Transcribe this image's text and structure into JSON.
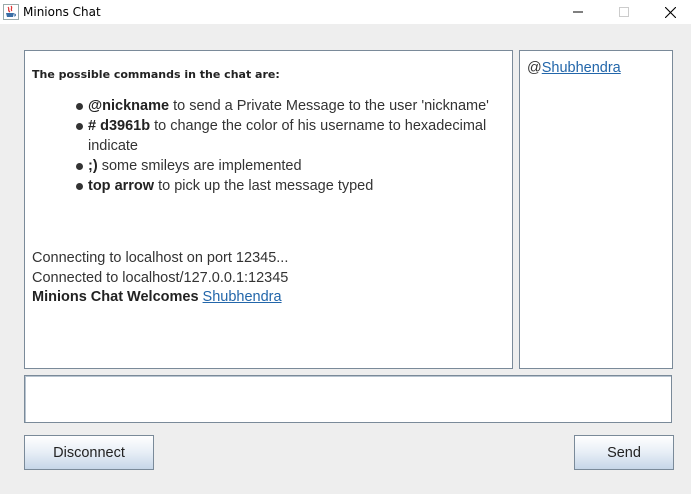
{
  "window": {
    "title": "Minions Chat",
    "icon": "java-cup-icon",
    "controls": [
      "minimize-icon",
      "maximize-icon",
      "close-icon"
    ]
  },
  "chat": {
    "heading": "The possible commands in the chat are:",
    "commands": [
      {
        "keyword": "@nickname",
        "description": " to send a Private Message to the user 'nickname'"
      },
      {
        "keyword": "# d3961b",
        "description": " to change the color of his username to hexadecimal indicate"
      },
      {
        "keyword": ";)",
        "description": " some smileys are implemented"
      },
      {
        "keyword": "top arrow",
        "description": " to pick up the last message typed"
      }
    ],
    "log": {
      "line1": "Connecting to localhost on port 12345...",
      "line2": "Connected to localhost/127.0.0.1:12345",
      "welcome_prefix": "Minions Chat Welcomes",
      "welcome_user": "Shubhendra"
    }
  },
  "users": {
    "prefix": "@",
    "list": [
      "Shubhendra"
    ]
  },
  "input": {
    "value": "",
    "placeholder": ""
  },
  "buttons": {
    "disconnect": "Disconnect",
    "send": "Send"
  }
}
